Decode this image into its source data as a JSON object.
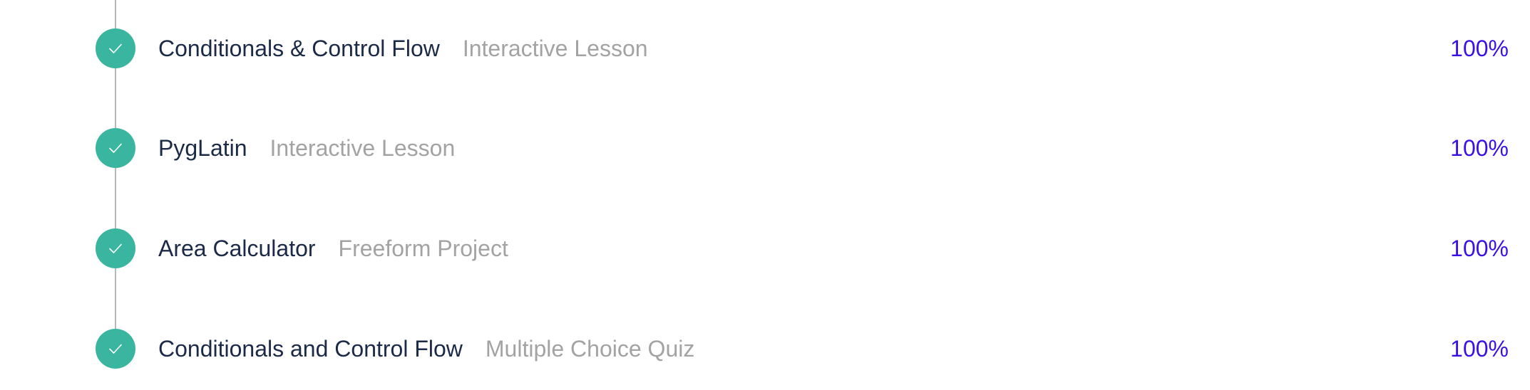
{
  "colors": {
    "check_fill": "#3ab5a0",
    "title": "#1b2a47",
    "subtitle": "#a3a3a3",
    "percent": "#3a10e5",
    "line": "#b8b8b8"
  },
  "items": [
    {
      "title": "Conditionals & Control Flow",
      "type": "Interactive Lesson",
      "progress": "100%",
      "status_icon": "checkmark-icon"
    },
    {
      "title": "PygLatin",
      "type": "Interactive Lesson",
      "progress": "100%",
      "status_icon": "checkmark-icon"
    },
    {
      "title": "Area Calculator",
      "type": "Freeform Project",
      "progress": "100%",
      "status_icon": "checkmark-icon"
    },
    {
      "title": "Conditionals and Control Flow",
      "type": "Multiple Choice Quiz",
      "progress": "100%",
      "status_icon": "checkmark-icon"
    }
  ]
}
